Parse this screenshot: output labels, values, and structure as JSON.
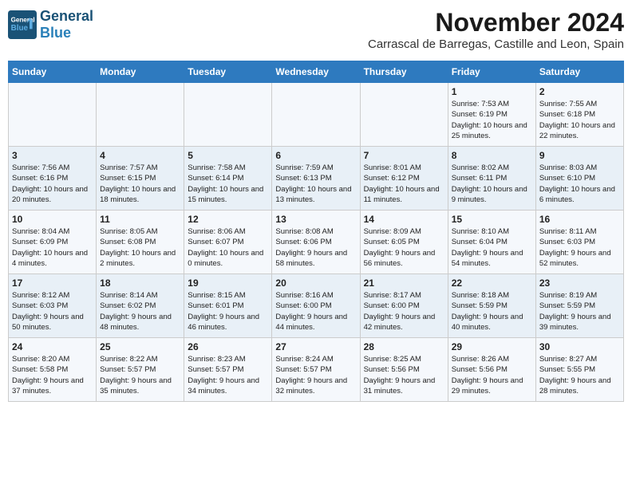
{
  "logo": {
    "general": "General",
    "blue": "Blue"
  },
  "title": "November 2024",
  "location": "Carrascal de Barregas, Castille and Leon, Spain",
  "days_of_week": [
    "Sunday",
    "Monday",
    "Tuesday",
    "Wednesday",
    "Thursday",
    "Friday",
    "Saturday"
  ],
  "weeks": [
    [
      {
        "day": "",
        "info": ""
      },
      {
        "day": "",
        "info": ""
      },
      {
        "day": "",
        "info": ""
      },
      {
        "day": "",
        "info": ""
      },
      {
        "day": "",
        "info": ""
      },
      {
        "day": "1",
        "info": "Sunrise: 7:53 AM\nSunset: 6:19 PM\nDaylight: 10 hours and 25 minutes."
      },
      {
        "day": "2",
        "info": "Sunrise: 7:55 AM\nSunset: 6:18 PM\nDaylight: 10 hours and 22 minutes."
      }
    ],
    [
      {
        "day": "3",
        "info": "Sunrise: 7:56 AM\nSunset: 6:16 PM\nDaylight: 10 hours and 20 minutes."
      },
      {
        "day": "4",
        "info": "Sunrise: 7:57 AM\nSunset: 6:15 PM\nDaylight: 10 hours and 18 minutes."
      },
      {
        "day": "5",
        "info": "Sunrise: 7:58 AM\nSunset: 6:14 PM\nDaylight: 10 hours and 15 minutes."
      },
      {
        "day": "6",
        "info": "Sunrise: 7:59 AM\nSunset: 6:13 PM\nDaylight: 10 hours and 13 minutes."
      },
      {
        "day": "7",
        "info": "Sunrise: 8:01 AM\nSunset: 6:12 PM\nDaylight: 10 hours and 11 minutes."
      },
      {
        "day": "8",
        "info": "Sunrise: 8:02 AM\nSunset: 6:11 PM\nDaylight: 10 hours and 9 minutes."
      },
      {
        "day": "9",
        "info": "Sunrise: 8:03 AM\nSunset: 6:10 PM\nDaylight: 10 hours and 6 minutes."
      }
    ],
    [
      {
        "day": "10",
        "info": "Sunrise: 8:04 AM\nSunset: 6:09 PM\nDaylight: 10 hours and 4 minutes."
      },
      {
        "day": "11",
        "info": "Sunrise: 8:05 AM\nSunset: 6:08 PM\nDaylight: 10 hours and 2 minutes."
      },
      {
        "day": "12",
        "info": "Sunrise: 8:06 AM\nSunset: 6:07 PM\nDaylight: 10 hours and 0 minutes."
      },
      {
        "day": "13",
        "info": "Sunrise: 8:08 AM\nSunset: 6:06 PM\nDaylight: 9 hours and 58 minutes."
      },
      {
        "day": "14",
        "info": "Sunrise: 8:09 AM\nSunset: 6:05 PM\nDaylight: 9 hours and 56 minutes."
      },
      {
        "day": "15",
        "info": "Sunrise: 8:10 AM\nSunset: 6:04 PM\nDaylight: 9 hours and 54 minutes."
      },
      {
        "day": "16",
        "info": "Sunrise: 8:11 AM\nSunset: 6:03 PM\nDaylight: 9 hours and 52 minutes."
      }
    ],
    [
      {
        "day": "17",
        "info": "Sunrise: 8:12 AM\nSunset: 6:03 PM\nDaylight: 9 hours and 50 minutes."
      },
      {
        "day": "18",
        "info": "Sunrise: 8:14 AM\nSunset: 6:02 PM\nDaylight: 9 hours and 48 minutes."
      },
      {
        "day": "19",
        "info": "Sunrise: 8:15 AM\nSunset: 6:01 PM\nDaylight: 9 hours and 46 minutes."
      },
      {
        "day": "20",
        "info": "Sunrise: 8:16 AM\nSunset: 6:00 PM\nDaylight: 9 hours and 44 minutes."
      },
      {
        "day": "21",
        "info": "Sunrise: 8:17 AM\nSunset: 6:00 PM\nDaylight: 9 hours and 42 minutes."
      },
      {
        "day": "22",
        "info": "Sunrise: 8:18 AM\nSunset: 5:59 PM\nDaylight: 9 hours and 40 minutes."
      },
      {
        "day": "23",
        "info": "Sunrise: 8:19 AM\nSunset: 5:59 PM\nDaylight: 9 hours and 39 minutes."
      }
    ],
    [
      {
        "day": "24",
        "info": "Sunrise: 8:20 AM\nSunset: 5:58 PM\nDaylight: 9 hours and 37 minutes."
      },
      {
        "day": "25",
        "info": "Sunrise: 8:22 AM\nSunset: 5:57 PM\nDaylight: 9 hours and 35 minutes."
      },
      {
        "day": "26",
        "info": "Sunrise: 8:23 AM\nSunset: 5:57 PM\nDaylight: 9 hours and 34 minutes."
      },
      {
        "day": "27",
        "info": "Sunrise: 8:24 AM\nSunset: 5:57 PM\nDaylight: 9 hours and 32 minutes."
      },
      {
        "day": "28",
        "info": "Sunrise: 8:25 AM\nSunset: 5:56 PM\nDaylight: 9 hours and 31 minutes."
      },
      {
        "day": "29",
        "info": "Sunrise: 8:26 AM\nSunset: 5:56 PM\nDaylight: 9 hours and 29 minutes."
      },
      {
        "day": "30",
        "info": "Sunrise: 8:27 AM\nSunset: 5:55 PM\nDaylight: 9 hours and 28 minutes."
      }
    ]
  ]
}
